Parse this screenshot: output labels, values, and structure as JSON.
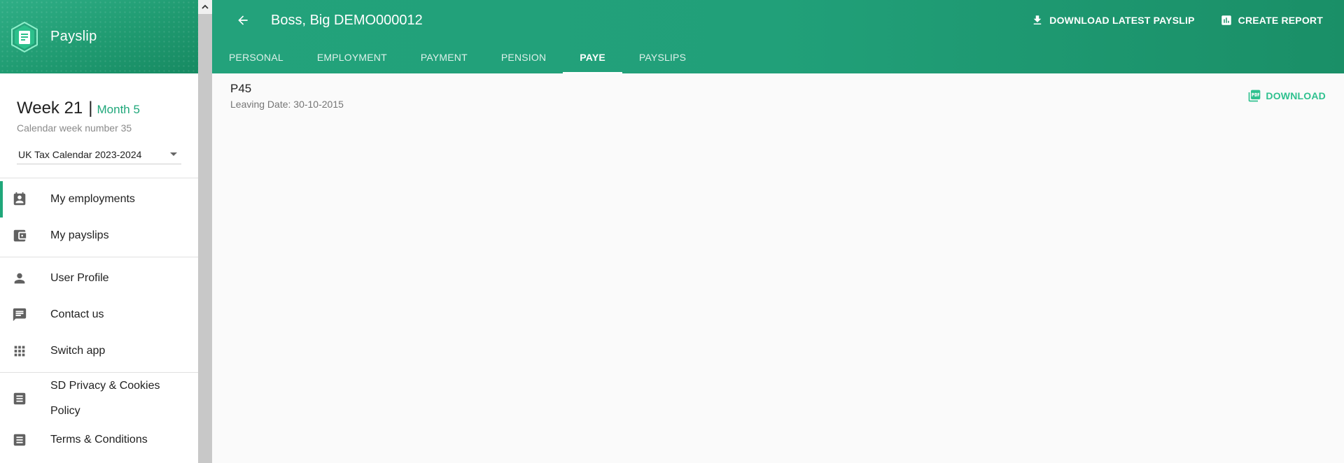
{
  "brand": {
    "name": "Payslip"
  },
  "week": {
    "title": "Week 21",
    "separator": "|",
    "month": "Month 5",
    "subtitle": "Calendar week number 35",
    "calendar_selected": "UK Tax Calendar 2023-2024"
  },
  "nav": {
    "primary": [
      {
        "label": "My employments",
        "icon": "employment-badge-icon",
        "active": true
      },
      {
        "label": "My payslips",
        "icon": "wallet-icon",
        "active": false
      }
    ],
    "secondary": [
      {
        "label": "User Profile",
        "icon": "person-icon"
      },
      {
        "label": "Contact us",
        "icon": "chat-icon"
      },
      {
        "label": "Switch app",
        "icon": "grid-icon"
      }
    ],
    "legal": [
      {
        "label": "SD Privacy & Cookies Policy",
        "icon": "document-icon"
      },
      {
        "label": "Terms & Conditions",
        "icon": "document-icon"
      }
    ]
  },
  "header": {
    "title": "Boss, Big DEMO000012",
    "download_latest": "DOWNLOAD LATEST PAYSLIP",
    "create_report": "CREATE REPORT"
  },
  "tabs": [
    {
      "label": "PERSONAL",
      "active": false
    },
    {
      "label": "EMPLOYMENT",
      "active": false
    },
    {
      "label": "PAYMENT",
      "active": false
    },
    {
      "label": "PENSION",
      "active": false
    },
    {
      "label": "PAYE",
      "active": true
    },
    {
      "label": "PAYSLIPS",
      "active": false
    }
  ],
  "document": {
    "title": "P45",
    "subtitle": "Leaving Date: 30-10-2015",
    "download_label": "DOWNLOAD"
  },
  "colors": {
    "brand_green": "#21a079",
    "accent_green": "#1fa77a",
    "download_green": "#2fc18f"
  }
}
